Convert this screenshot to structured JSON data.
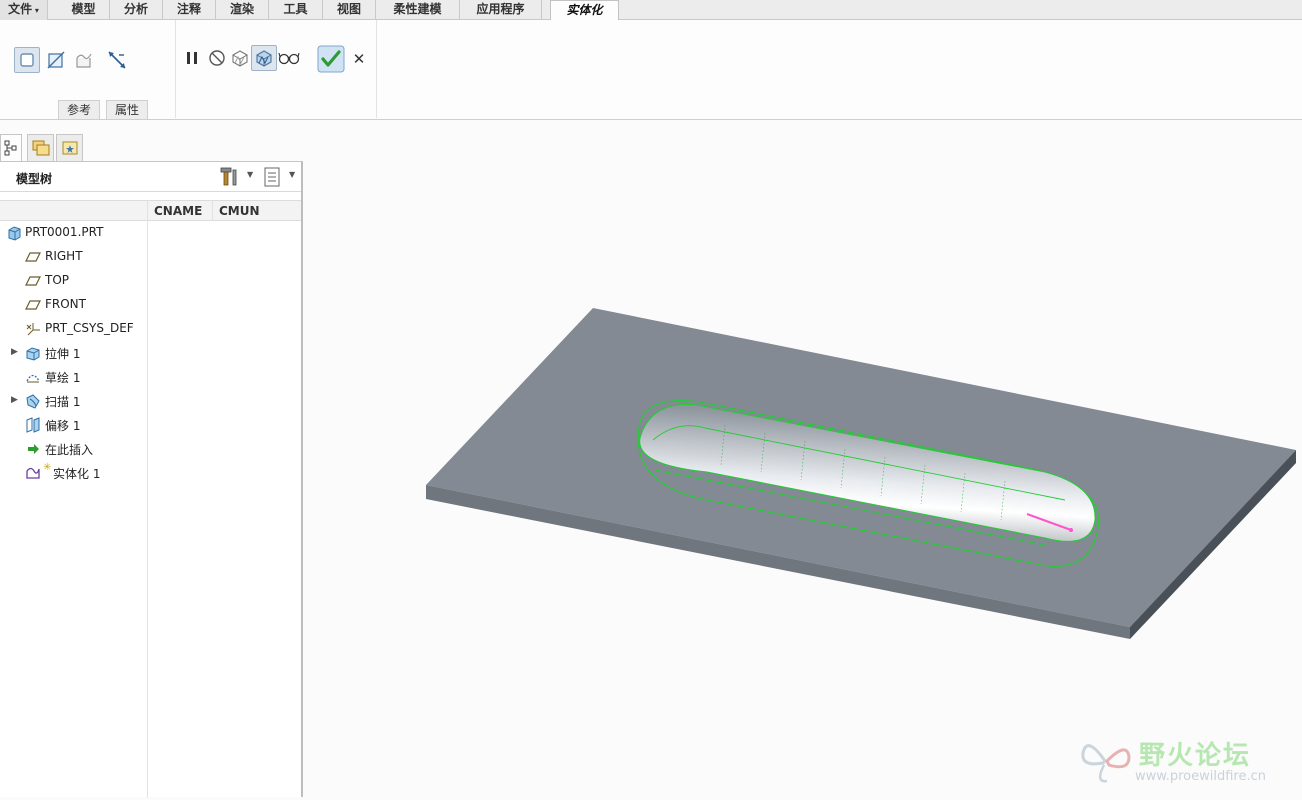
{
  "menu_tabs": [
    {
      "label": "文件",
      "has_caret": true
    },
    {
      "label": "模型"
    },
    {
      "label": "分析"
    },
    {
      "label": "注释"
    },
    {
      "label": "渲染"
    },
    {
      "label": "工具"
    },
    {
      "label": "视图"
    },
    {
      "label": "柔性建模"
    },
    {
      "label": "应用程序"
    },
    {
      "label": "实体化",
      "active": true
    }
  ],
  "ribbon": {
    "subtabs": [
      "参考",
      "属性"
    ],
    "icons": [
      "solid-fill-icon",
      "remove-material-icon",
      "surface-patch-icon",
      "flip-direction-icon",
      "pause-icon",
      "no-preview-icon",
      "preview-icon",
      "verify-icon",
      "glasses-icon",
      "ok-check-icon",
      "cancel-x-icon"
    ],
    "cancel_label": "✕"
  },
  "model_tree": {
    "title": "模型树",
    "columns": [
      "CNAME",
      "CMUN"
    ],
    "items": [
      {
        "label": "PRT0001.PRT",
        "icon": "part-icon",
        "expandable": false
      },
      {
        "label": "RIGHT",
        "icon": "datum-plane-icon",
        "expandable": false
      },
      {
        "label": "TOP",
        "icon": "datum-plane-icon",
        "expandable": false
      },
      {
        "label": "FRONT",
        "icon": "datum-plane-icon",
        "expandable": false
      },
      {
        "label": "PRT_CSYS_DEF",
        "icon": "coordinate-system-icon",
        "expandable": false
      },
      {
        "label": "拉伸 1",
        "icon": "extrude-icon",
        "expandable": true
      },
      {
        "label": "草绘 1",
        "icon": "sketch-icon",
        "expandable": false
      },
      {
        "label": "扫描 1",
        "icon": "sweep-icon",
        "expandable": true
      },
      {
        "label": "偏移 1",
        "icon": "offset-icon",
        "expandable": false
      },
      {
        "label": "在此插入",
        "icon": "insert-here-arrow-icon",
        "expandable": false
      },
      {
        "label": "实体化 1",
        "icon": "solidify-icon",
        "expandable": false
      }
    ]
  },
  "watermark": {
    "title": "野火论坛",
    "url": "www.proewildfire.cn"
  },
  "colors": {
    "plate_top": "#838a93",
    "plate_side": "#585e66",
    "highlight_edge": "#22cc33",
    "accent_pink": "#ff55cc",
    "ok_green": "#3aa83a"
  }
}
